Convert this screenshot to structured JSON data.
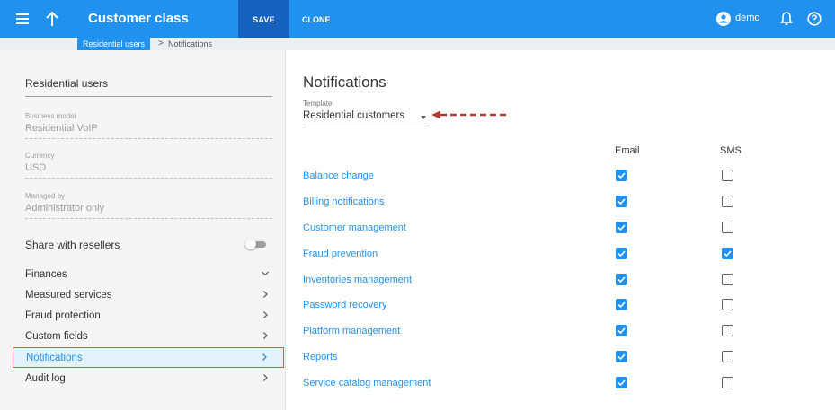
{
  "header": {
    "title": "Customer class",
    "save_label": "SAVE",
    "clone_label": "CLONE",
    "user": "demo"
  },
  "breadcrumb": {
    "parent": "Residential users",
    "separator": ">",
    "current": "Notifications"
  },
  "left_panel": {
    "name_value": "Residential users",
    "fields": [
      {
        "label": "Business model",
        "value": "Residential VoIP"
      },
      {
        "label": "Currency",
        "value": "USD"
      },
      {
        "label": "Managed by",
        "value": "Administrator only"
      }
    ],
    "share_label": "Share with resellers",
    "share_enabled": false,
    "nav": [
      {
        "label": "Finances",
        "chevron": "chevron-down"
      },
      {
        "label": "Measured services",
        "chevron": "chevron-right"
      },
      {
        "label": "Fraud protection",
        "chevron": "chevron-right"
      },
      {
        "label": "Custom fields",
        "chevron": "chevron-right"
      },
      {
        "label": "Notifications",
        "chevron": "chevron-right",
        "active": true
      },
      {
        "label": "Audit log",
        "chevron": "chevron-right"
      }
    ]
  },
  "main": {
    "title": "Notifications",
    "template_label": "Template",
    "template_value": "Residential customers",
    "columns": {
      "email": "Email",
      "sms": "SMS"
    },
    "rows": [
      {
        "label": "Balance change",
        "email": true,
        "sms": false
      },
      {
        "label": "Billing notifications",
        "email": true,
        "sms": false
      },
      {
        "label": "Customer management",
        "email": true,
        "sms": false
      },
      {
        "label": "Fraud prevention",
        "email": true,
        "sms": true
      },
      {
        "label": "Inventories management",
        "email": true,
        "sms": false
      },
      {
        "label": "Password recovery",
        "email": true,
        "sms": false
      },
      {
        "label": "Platform management",
        "email": true,
        "sms": false
      },
      {
        "label": "Reports",
        "email": true,
        "sms": false
      },
      {
        "label": "Service catalog management",
        "email": true,
        "sms": false
      }
    ]
  },
  "colors": {
    "accent": "#2191f0",
    "save_button": "#1561bf",
    "highlight_border": "#d9534f",
    "annotation_arrow": "#b23a2e"
  }
}
